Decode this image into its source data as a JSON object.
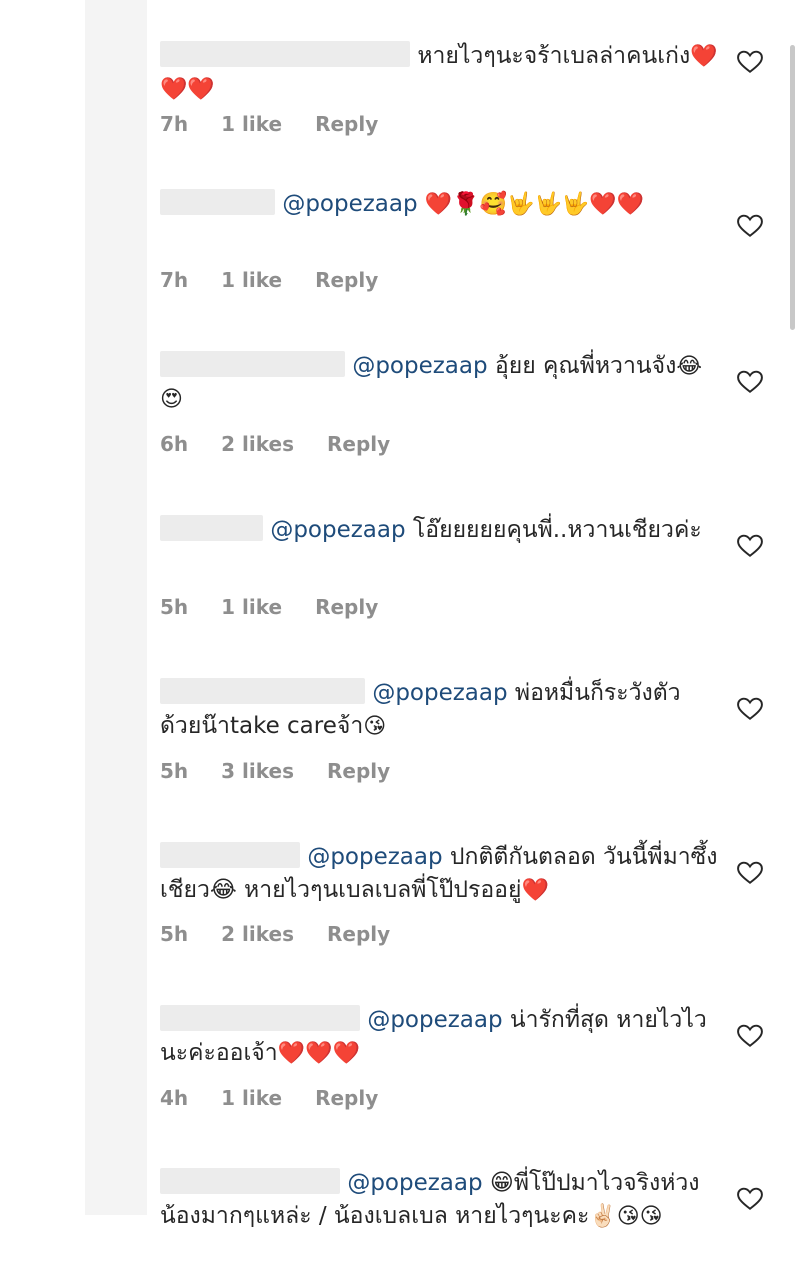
{
  "comments": [
    {
      "mention": "",
      "text": "หายไวๆนะจร้าเบลล่าคนเก่ง",
      "emoji": "❤️❤️❤️",
      "time": "7h",
      "likes": "1 like",
      "reply": "Reply"
    },
    {
      "mention": "@popezaap",
      "text": " ",
      "emoji": "❤️🌹🥰🤟🤟🤟❤️❤️",
      "time": "7h",
      "likes": "1 like",
      "reply": "Reply"
    },
    {
      "mention": "@popezaap",
      "text": " อุ้ยย  คุณพี่หวานจัง",
      "emoji": "😂😍",
      "time": "6h",
      "likes": "2 likes",
      "reply": "Reply"
    },
    {
      "mention": "@popezaap",
      "text": " โอ๊ยยยยยคุนพี่..หวานเชียวค่ะ",
      "emoji": "",
      "time": "5h",
      "likes": "1 like",
      "reply": "Reply"
    },
    {
      "mention": "@popezaap",
      "text": " พ่อหมื่นก็ระวังตัวด้วยน๊าtake careจ้า",
      "emoji": "😘",
      "time": "5h",
      "likes": "3 likes",
      "reply": "Reply"
    },
    {
      "mention": "@popezaap",
      "text": " ปกติตีกันตลอด วันนี้พี่มาซึ้งเชียว😂 หายไวๆนเบลเบลพี่โป๊ปรออยู่",
      "emoji": "❤️",
      "time": "5h",
      "likes": "2 likes",
      "reply": "Reply"
    },
    {
      "mention": "@popezaap",
      "text": " น่ารักที่สุด หายไวไวนะค่ะออเจ้า",
      "emoji": "❤️❤️❤️",
      "time": "4h",
      "likes": "1 like",
      "reply": "Reply"
    },
    {
      "mention": "@popezaap",
      "text": " 😁พี่โป๊ปมาไวจริงห่วงน้องมากๆแหล่ะ / น้องเบลเบล หายไวๆนะคะ",
      "emoji": "✌🏻😘😘",
      "time": "",
      "likes": "",
      "reply": ""
    }
  ]
}
